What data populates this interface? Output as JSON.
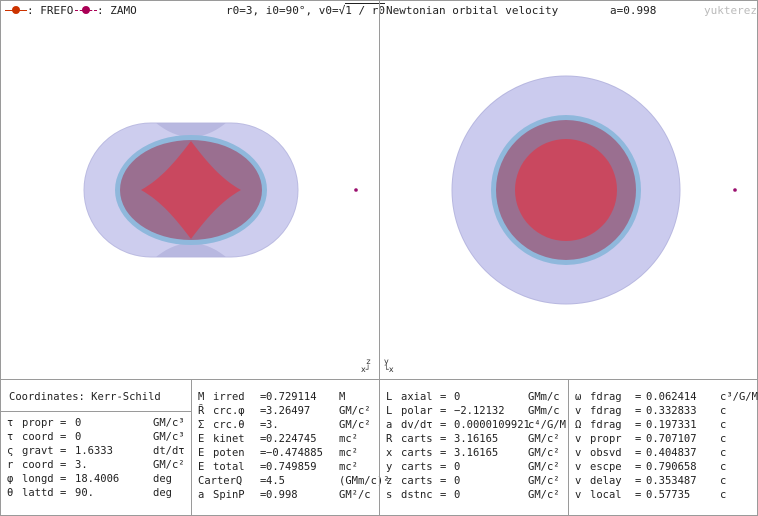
{
  "legend": {
    "frefo_label": ": FREFO",
    "zamo_label": ": ZAMO",
    "frefo_color": "#cc3300",
    "zamo_color": "#aa0055"
  },
  "left_header": {
    "params_prefix": "r0=3, i0=90°, v0=",
    "params_sqrt": "1 / r0"
  },
  "right_header": {
    "title": "Newtonian orbital velocity",
    "spin": "a=0.998",
    "watermark": "yukterez"
  },
  "axes": {
    "left_corner": "z\nx┘",
    "right_corner": "y\n└x"
  },
  "panel1": {
    "title": "Coordinates: Kerr-Schild",
    "rows": [
      {
        "sym": "τ",
        "name": "propr",
        "eq": "=",
        "val": "0",
        "unit": "GM/c³"
      },
      {
        "sym": "τ",
        "name": "coord",
        "eq": "=",
        "val": "0",
        "unit": "GM/c³"
      },
      {
        "sym": "ς",
        "name": "gravt",
        "eq": "=",
        "val": "1.6333",
        "unit": "dt/dτ"
      },
      {
        "sym": "r",
        "name": "coord",
        "eq": "=",
        "val": "3.",
        "unit": "GM/c²"
      },
      {
        "sym": "φ",
        "name": "longd",
        "eq": "=",
        "val": "18.4006",
        "unit": "deg"
      },
      {
        "sym": "θ",
        "name": "lattd",
        "eq": "=",
        "val": "90.",
        "unit": "deg"
      }
    ]
  },
  "panel2": {
    "rows": [
      {
        "sym": "M",
        "name": "irred",
        "eq": "=",
        "val": "0.729114",
        "unit": "M"
      },
      {
        "sym": "Ȓ",
        "name": "crc.φ",
        "eq": "=",
        "val": "3.26497",
        "unit": "GM/c²"
      },
      {
        "sym": "Σ",
        "name": "crc.θ",
        "eq": "=",
        "val": "3.",
        "unit": "GM/c²"
      },
      {
        "sym": "E",
        "name": "kinet",
        "eq": "=",
        "val": "0.224745",
        "unit": "mc²"
      },
      {
        "sym": "E",
        "name": "poten",
        "eq": "=",
        "val": "−0.474885",
        "unit": "mc²"
      },
      {
        "sym": "E",
        "name": "total",
        "eq": "=",
        "val": "0.749859",
        "unit": "mc²"
      },
      {
        "sym": "",
        "name": "CarterQ",
        "eq": "=",
        "val": "4.5",
        "unit": "(GMm/c)²"
      },
      {
        "sym": "a",
        "name": "SpinP",
        "eq": "=",
        "val": "0.998",
        "unit": "GM²/c"
      }
    ]
  },
  "panel3": {
    "rows": [
      {
        "sym": "L",
        "name": "axial",
        "eq": "=",
        "val": "0",
        "unit": "GMm/c"
      },
      {
        "sym": "L",
        "name": "polar",
        "eq": "=",
        "val": "−2.12132",
        "unit": "GMm/c"
      },
      {
        "sym": "a",
        "name": "dv/dτ",
        "eq": "=",
        "val": "0.0000109921",
        "unit": "c⁴/G/M"
      },
      {
        "sym": "R",
        "name": "carts",
        "eq": "=",
        "val": "3.16165",
        "unit": "GM/c²"
      },
      {
        "sym": "x",
        "name": "carts",
        "eq": "=",
        "val": "3.16165",
        "unit": "GM/c²"
      },
      {
        "sym": "y",
        "name": "carts",
        "eq": "=",
        "val": "0",
        "unit": "GM/c²"
      },
      {
        "sym": "z",
        "name": "carts",
        "eq": "=",
        "val": "0",
        "unit": "GM/c²"
      },
      {
        "sym": "s",
        "name": "dstnc",
        "eq": "=",
        "val": "0",
        "unit": "GM/c²"
      }
    ]
  },
  "panel4": {
    "rows": [
      {
        "sym": "ω",
        "name": "fdrag",
        "eq": "=",
        "val": "0.062414",
        "unit": "c³/G/M"
      },
      {
        "sym": "v",
        "name": "fdrag",
        "eq": "=",
        "val": "0.332833",
        "unit": "c"
      },
      {
        "sym": "Ω",
        "name": "fdrag",
        "eq": "=",
        "val": "0.197331",
        "unit": "c"
      },
      {
        "sym": "v",
        "name": "propr",
        "eq": "=",
        "val": "0.707107",
        "unit": "c"
      },
      {
        "sym": "v",
        "name": "obsvd",
        "eq": "=",
        "val": "0.404837",
        "unit": "c"
      },
      {
        "sym": "v",
        "name": "escpe",
        "eq": "=",
        "val": "0.790658",
        "unit": "c"
      },
      {
        "sym": "v",
        "name": "delay",
        "eq": "=",
        "val": "0.353487",
        "unit": "c"
      },
      {
        "sym": "v",
        "name": "local",
        "eq": "=",
        "val": "0.57735",
        "unit": "c"
      }
    ]
  },
  "colors": {
    "ergosphere": "#c9c9ee",
    "horizon_ring": "#8fb8dc",
    "inner_body": "#9a6c8c",
    "singularity": "#c8485e",
    "particle": "#9a0f6e"
  }
}
